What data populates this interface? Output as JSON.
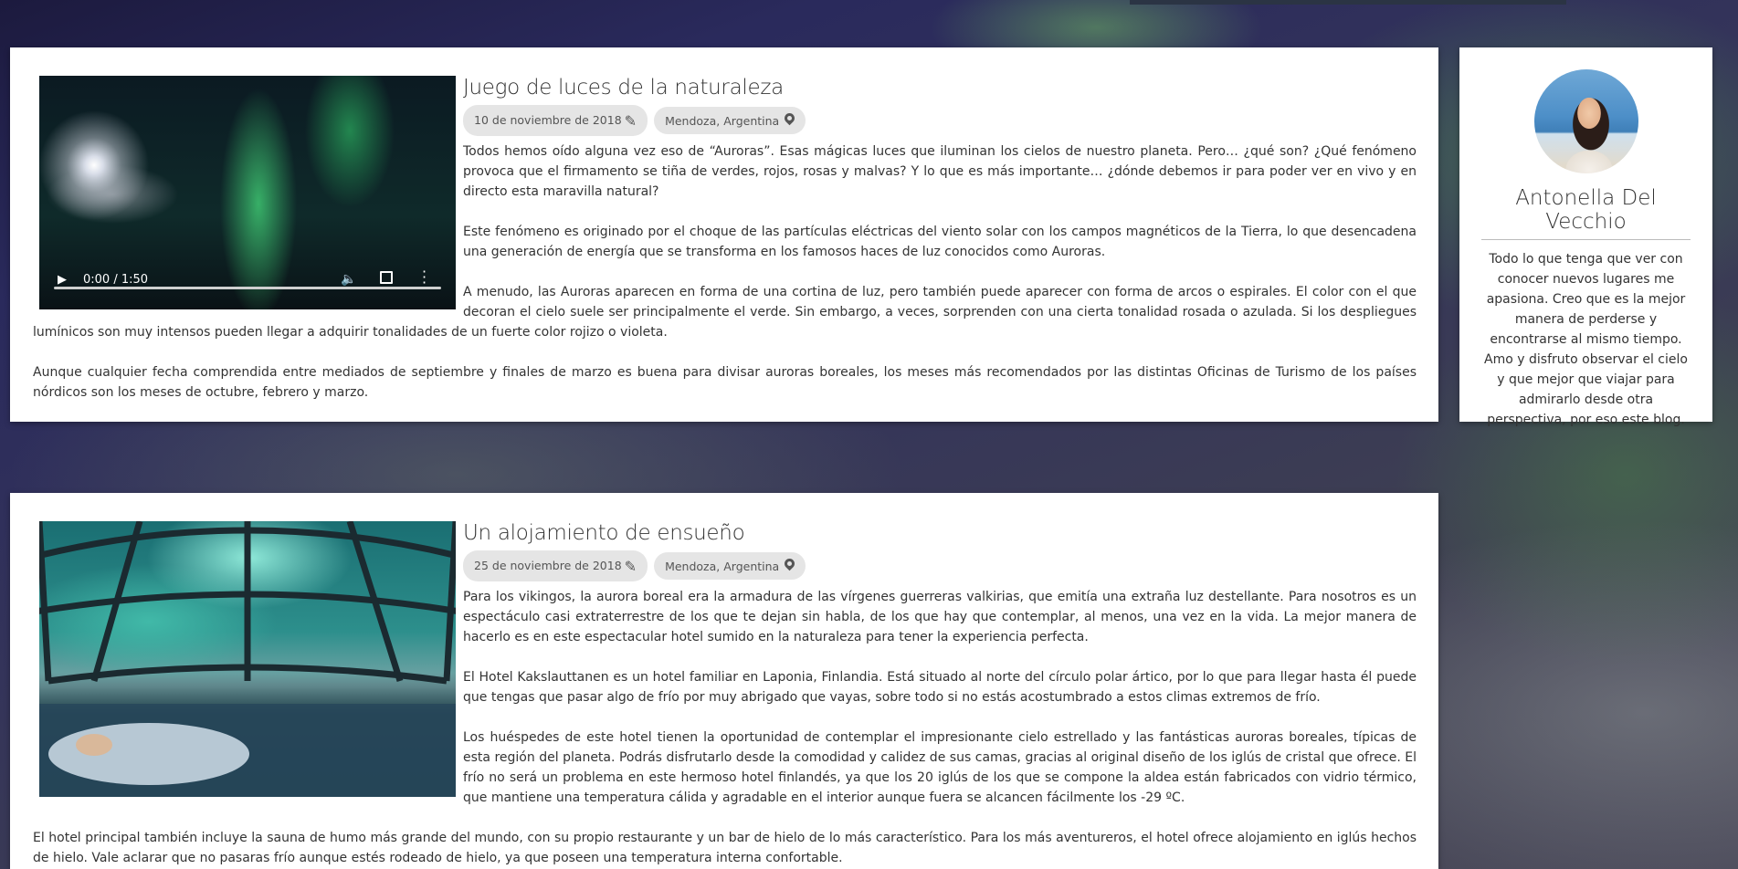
{
  "posts": [
    {
      "title": "Juego de luces de la naturaleza",
      "date": "10 de noviembre de 2018",
      "location": "Mendoza, Argentina",
      "media_type": "video",
      "video_time": "0:00 / 1:50",
      "paragraphs": [
        "Todos hemos oído alguna vez eso de “Auroras”. Esas mágicas luces que iluminan los cielos de nuestro planeta. Pero… ¿qué son? ¿Qué fenómeno provoca que el firmamento se tiña de verdes, rojos, rosas y malvas? Y lo que es más importante… ¿dónde debemos ir para poder ver en vivo y en directo esta maravilla natural?",
        "Este fenómeno es originado por el choque de las partículas eléctricas del viento solar con los campos magnéticos de la Tierra, lo que desencadena una generación de energía que se transforma en los famosos haces de luz conocidos como Auroras.",
        "A menudo, las Auroras aparecen en forma de una cortina de luz, pero también puede aparecer con forma de arcos o espirales. El color con el que decoran el cielo suele ser principalmente el verde. Sin embargo, a veces, sorprenden con una cierta tonalidad rosada o azulada. Si los despliegues lumínicos son muy intensos pueden llegar a adquirir tonalidades de un fuerte color rojizo o violeta.",
        "Aunque cualquier fecha comprendida entre mediados de septiembre y finales de marzo es buena para divisar auroras boreales, los meses más recomendados por las distintas Oficinas de Turismo de los países nórdicos son los meses de octubre, febrero y marzo."
      ]
    },
    {
      "title": "Un alojamiento de ensueño",
      "date": "25 de noviembre de 2018",
      "location": "Mendoza, Argentina",
      "media_type": "image",
      "paragraphs": [
        "Para los vikingos, la aurora boreal era la armadura de las vírgenes guerreras valkirias, que emitía una extraña luz destellante. Para nosotros es un espectáculo casi extraterrestre de los que te dejan sin habla, de los que hay que contemplar, al menos, una vez en la vida. La mejor manera de hacerlo es en este espectacular hotel sumido en la naturaleza para tener la experiencia perfecta.",
        "El Hotel Kakslauttanen es un hotel familiar en Laponia, Finlandia. Está situado al norte del círculo polar ártico, por lo que para llegar hasta él puede que tengas que pasar algo de frío por muy abrigado que vayas, sobre todo si no estás acostumbrado a estos climas extremos de frío.",
        "Los huéspedes de este hotel tienen la oportunidad de contemplar el impresionante cielo estrellado y las fantásticas auroras boreales, típicas de esta región del planeta. Podrás disfrutarlo desde la comodidad y calidez de sus camas, gracias al original diseño de los iglús de cristal que ofrece. El frío no será un problema en este hermoso hotel finlandés, ya que los 20 iglús de los que se compone la aldea están fabricados con vidrio térmico, que mantiene una temperatura cálida y agradable en el interior aunque fuera se alcancen fácilmente los -29 ºC.",
        "El hotel principal también incluye la sauna de humo más grande del mundo, con su propio restaurante y un bar de hielo de lo más característico. Para los más aventureros, el hotel ofrece alojamiento en iglús hechos de hielo. Vale aclarar que no pasaras frío aunque estés rodeado de hielo, ya que poseen una temperatura interna confortable."
      ]
    }
  ],
  "profile": {
    "name": "Antonella Del Vecchio",
    "bio": "Todo lo que tenga que ver con conocer nuevos lugares me apasiona. Creo que es la mejor manera de perderse y encontrarse al mismo tiempo. Amo y disfruto observar el cielo y que mejor que viajar para admirarlo desde otra perspectiva, por eso este blog."
  },
  "icons": {
    "date": "pencil-icon",
    "location": "map-pin-icon",
    "play": "play-icon",
    "volume": "volume-icon",
    "fullscreen": "fullscreen-icon",
    "more": "more-vertical-icon"
  }
}
